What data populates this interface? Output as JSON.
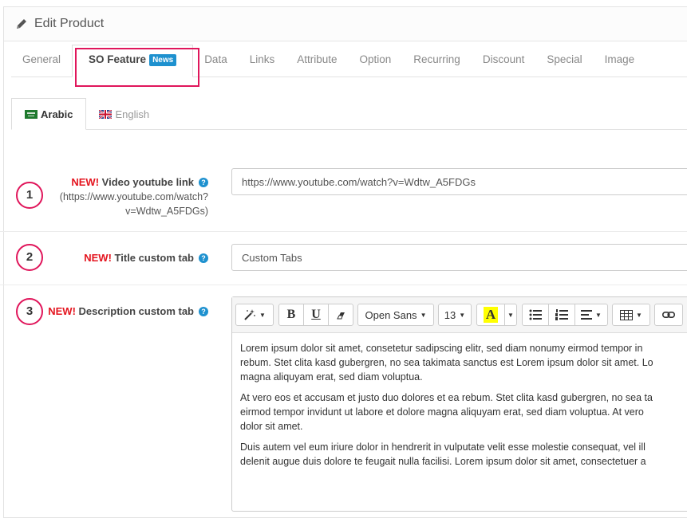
{
  "header": {
    "title": "Edit Product"
  },
  "tabs": [
    {
      "label": "General"
    },
    {
      "label": "SO Feature",
      "badge": "News"
    },
    {
      "label": "Data"
    },
    {
      "label": "Links"
    },
    {
      "label": "Attribute"
    },
    {
      "label": "Option"
    },
    {
      "label": "Recurring"
    },
    {
      "label": "Discount"
    },
    {
      "label": "Special"
    },
    {
      "label": "Image"
    }
  ],
  "languages": [
    {
      "label": "Arabic",
      "flag": "sa-flag-icon"
    },
    {
      "label": "English",
      "flag": "uk-flag-icon"
    }
  ],
  "fields": {
    "video": {
      "number": "1",
      "new": "NEW!",
      "label": "Video youtube link",
      "hint_line1": "(https://www.youtube.com/watch?",
      "hint_line2": "v=Wdtw_A5FDGs)",
      "value": "https://www.youtube.com/watch?v=Wdtw_A5FDGs"
    },
    "title": {
      "number": "2",
      "new": "NEW!",
      "label": "Title custom tab",
      "value": "Custom Tabs"
    },
    "description": {
      "number": "3",
      "new": "NEW!",
      "label": "Description custom tab"
    }
  },
  "toolbar": {
    "font_name": "Open Sans",
    "font_size": "13",
    "bold": "B",
    "underline": "U",
    "color_letter": "A"
  },
  "editor": {
    "p1_l1": "Lorem ipsum dolor sit amet, consetetur sadipscing elitr, sed diam nonumy eirmod tempor in",
    "p1_l2": "rebum. Stet clita kasd gubergren, no sea takimata sanctus est Lorem ipsum dolor sit amet. Lo",
    "p1_l3": "magna aliquyam erat, sed diam voluptua.",
    "p2_l1": "At vero eos et accusam et justo duo dolores et ea rebum. Stet clita kasd gubergren, no sea ta",
    "p2_l2": "eirmod tempor invidunt ut labore et dolore magna aliquyam erat, sed diam voluptua. At vero",
    "p2_l3": "dolor sit amet.",
    "p3_l1": "Duis autem vel eum iriure dolor in hendrerit in vulputate velit esse molestie consequat, vel ill",
    "p3_l2": "delenit augue duis dolore te feugait nulla facilisi. Lorem ipsum dolor sit amet, consectetuer a"
  },
  "colors": {
    "accent": "#1e91cf",
    "highlight": "#e0165b",
    "new": "#e4151f"
  }
}
